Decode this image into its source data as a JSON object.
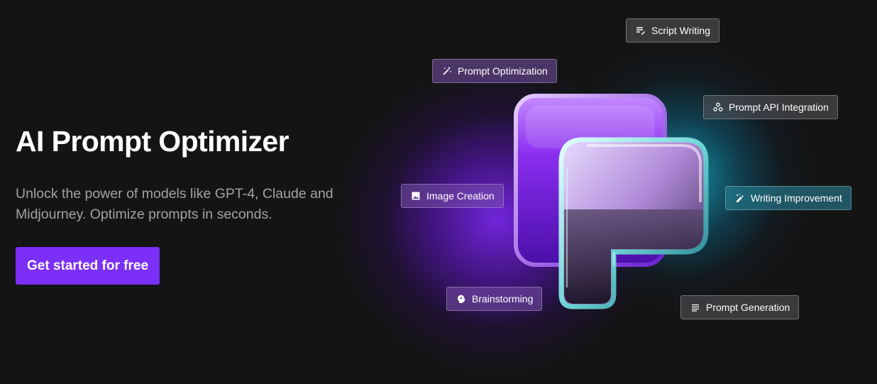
{
  "hero": {
    "title": "AI Prompt Optimizer",
    "subtitle": "Unlock the power of models like GPT-4, Claude and Midjourney. Optimize prompts in seconds.",
    "cta_label": "Get started for free"
  },
  "tags": [
    {
      "label": "Script Writing",
      "icon": "script-writing-icon"
    },
    {
      "label": "Prompt Optimization",
      "icon": "magic-wand-icon"
    },
    {
      "label": "Prompt API Integration",
      "icon": "api-integration-icon"
    },
    {
      "label": "Image Creation",
      "icon": "image-icon"
    },
    {
      "label": "Writing Improvement",
      "icon": "edit-note-icon"
    },
    {
      "label": "Brainstorming",
      "icon": "brain-icon"
    },
    {
      "label": "Prompt Generation",
      "icon": "lines-icon"
    }
  ],
  "colors": {
    "background": "#141414",
    "accent": "#7b2ff7",
    "glow_purple": "#8228ff",
    "glow_cyan": "#14bedc",
    "subtitle_text": "#a3a3a3"
  }
}
